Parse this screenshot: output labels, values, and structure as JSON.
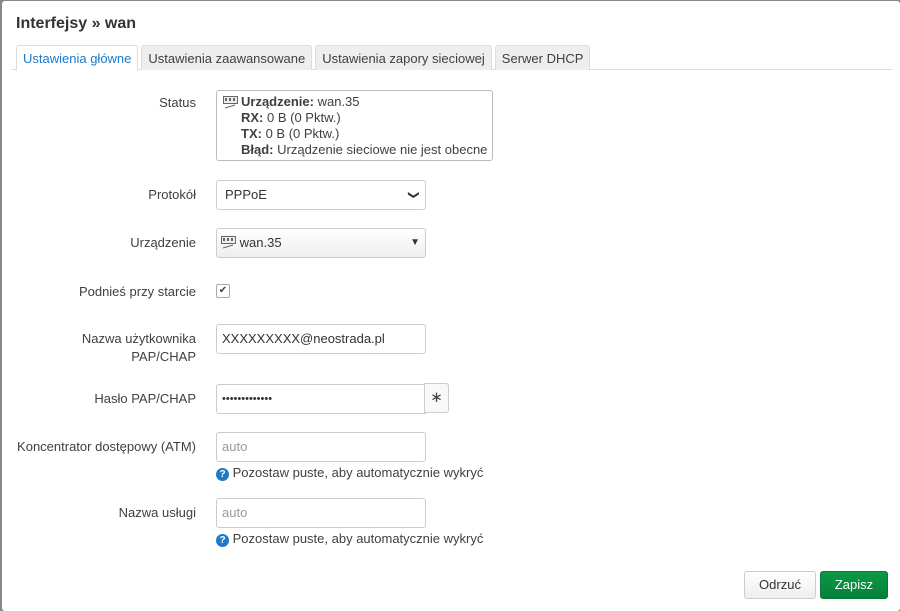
{
  "title": "Interfejsy » wan",
  "tabs": [
    "Ustawienia główne",
    "Ustawienia zaawansowane",
    "Ustawienia zapory sieciowej",
    "Serwer DHCP"
  ],
  "status": {
    "label": "Status",
    "device_k": "Urządzenie:",
    "device_v": "wan.35",
    "rx_k": "RX:",
    "rx_v": "0 B (0 Pktw.)",
    "tx_k": "TX:",
    "tx_v": "0 B (0 Pktw.)",
    "err_k": "Błąd:",
    "err_v": "Urządzenie sieciowe nie jest obecne"
  },
  "protocol": {
    "label": "Protokół",
    "value": "PPPoE"
  },
  "device": {
    "label": "Urządzenie",
    "value": "wan.35"
  },
  "autostart": {
    "label": "Podnieś przy starcie",
    "checked": true
  },
  "username": {
    "label1": "Nazwa użytkownika",
    "label2": "PAP/CHAP",
    "value": "XXXXXXXXX@neostrada.pl"
  },
  "password": {
    "label": "Hasło PAP/CHAP",
    "value": "•••••••••••••",
    "reveal": "∗"
  },
  "ac": {
    "label": "Koncentrator dostępowy (ATM)",
    "placeholder": "auto",
    "help": "Pozostaw puste, aby automatycznie wykryć"
  },
  "service": {
    "label": "Nazwa usługi",
    "placeholder": "auto",
    "help": "Pozostaw puste, aby automatycznie wykryć"
  },
  "buttons": {
    "dismiss": "Odrzuć",
    "save": "Zapisz"
  },
  "colors": {
    "accent": "#1e7ac8",
    "save": "#0a8f3e"
  }
}
